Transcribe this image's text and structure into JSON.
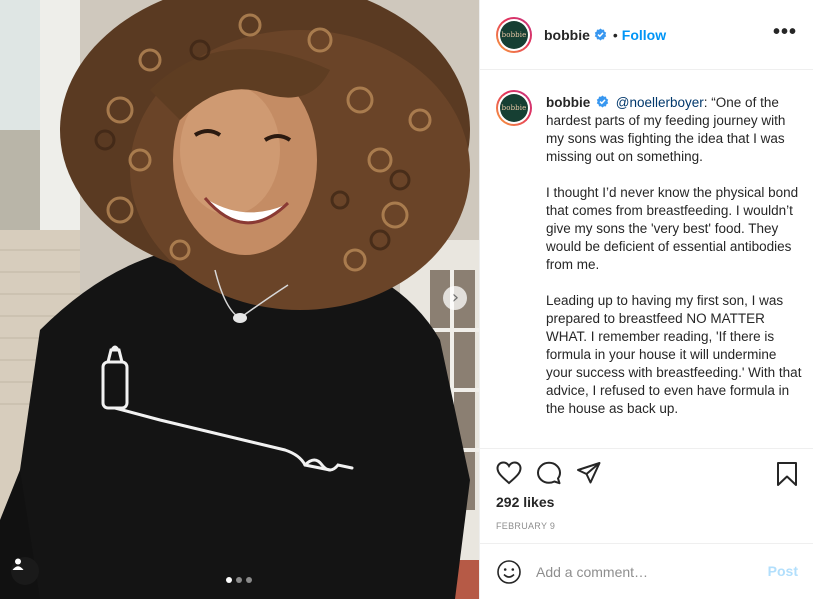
{
  "post": {
    "username": "bobbie",
    "verified": true,
    "follow_label": "Follow",
    "separator": "•",
    "more_label": "•••",
    "avatar_text": "bobbie",
    "caption": {
      "username": "bobbie",
      "mention": "@noellerboyer",
      "paragraph_1": ": “One of the hardest parts of my feeding journey with my sons was fighting the idea that I was missing out on something.",
      "paragraph_2": "I thought I’d never know the physical bond that comes from breastfeeding. I wouldn’t give my sons the 'very best' food. They would be deficient of essential antibodies from me.",
      "paragraph_3": "Leading up to having my first son, I was prepared to breastfeed NO MATTER WHAT. I remember reading, 'If there is formula in your house it will undermine your success with breastfeeding.' With that advice, I refused to even have formula in the house as back up."
    },
    "likes": "292 likes",
    "date": "FEBRUARY 9",
    "comment": {
      "placeholder": "Add a comment…",
      "value": "",
      "post_label": "Post"
    },
    "carousel": {
      "slide_count": 3,
      "active_slide": 1,
      "next_arrow": "›"
    },
    "icons": {
      "like": "heart-icon",
      "comment": "comment-icon",
      "share": "paper-plane-icon",
      "save": "bookmark-icon",
      "emoji": "smiley-icon",
      "user_tag": "user-tag-icon",
      "verified": "verified-badge-icon"
    },
    "colors": {
      "link_blue": "#0095f6",
      "post_disabled": "#b2dffc",
      "avatar_bg": "#163f33",
      "text": "#262626",
      "muted": "#8e8e8e"
    }
  }
}
